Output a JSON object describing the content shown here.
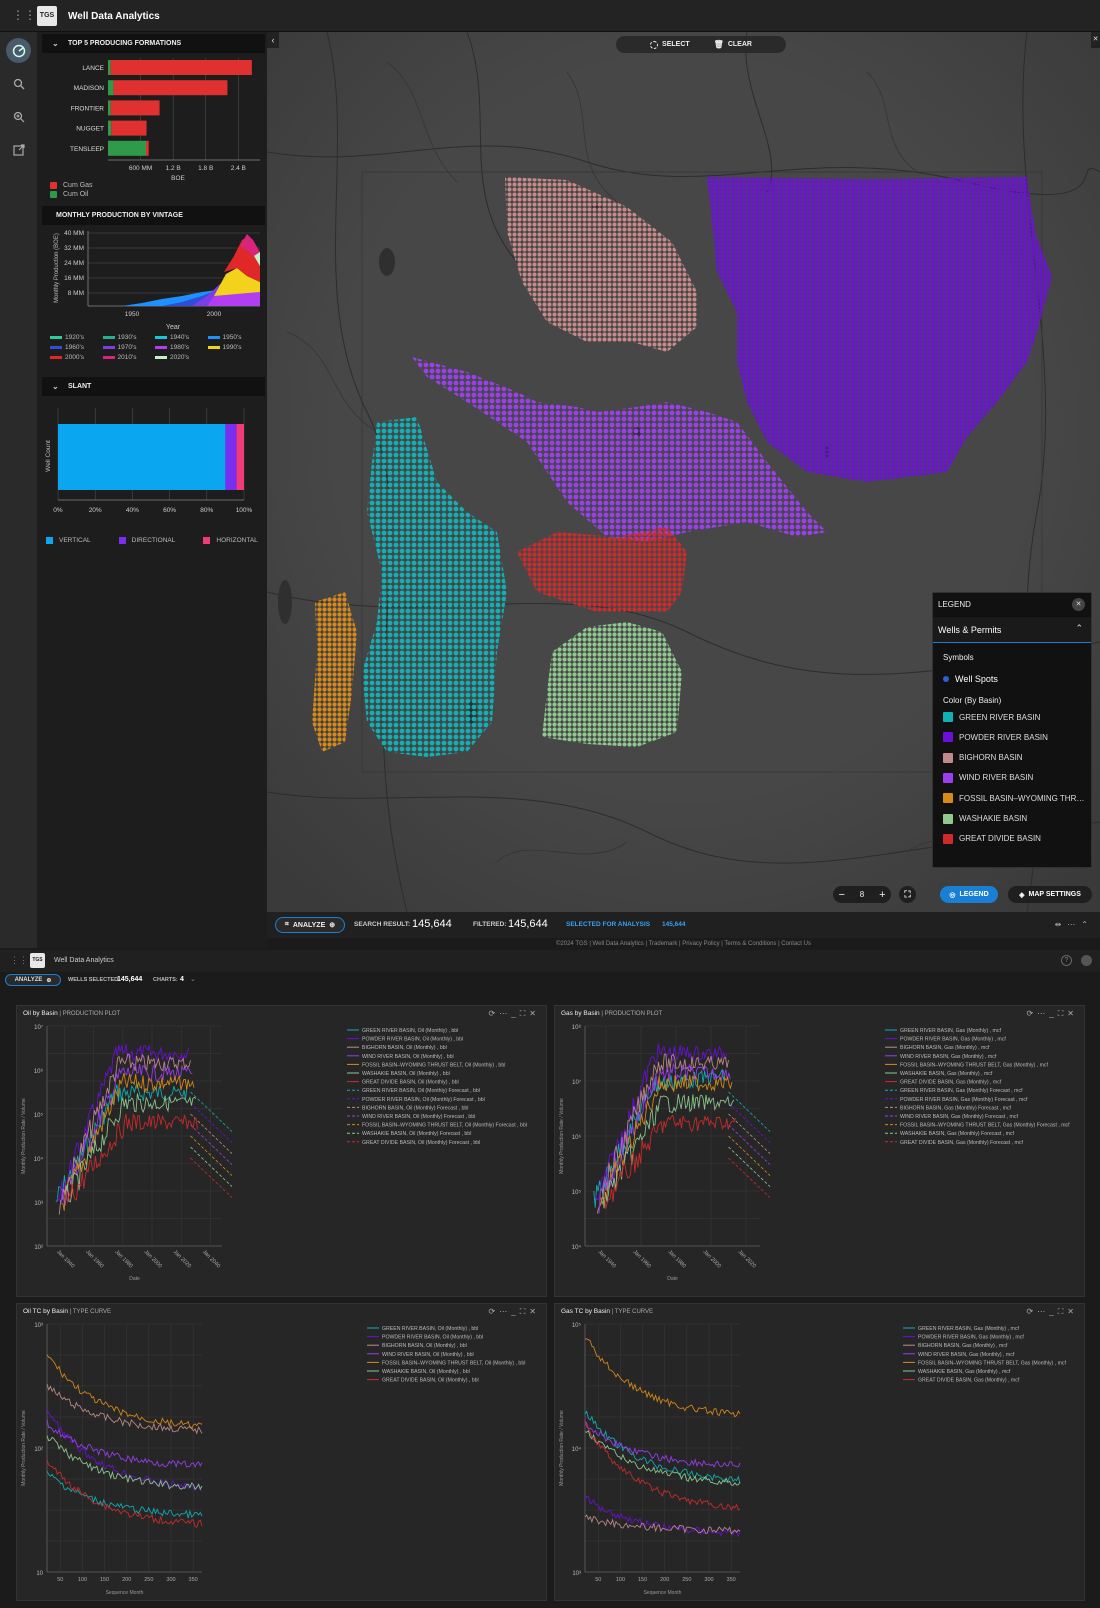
{
  "app": {
    "title": "Well Data Analytics",
    "logo_text": "TGS"
  },
  "panel": {
    "formations": {
      "title": "TOP 5 PRODUCING FORMATIONS",
      "xlabel": "BOE",
      "ticks": [
        "600 MM",
        "1.2 B",
        "1.8 B",
        "2.4 B"
      ],
      "legend": [
        {
          "label": "Cum Gas",
          "color": "#e03030"
        },
        {
          "label": "Cum Oil",
          "color": "#2e9a4a"
        }
      ]
    },
    "vintage": {
      "title": "MONTHLY PRODUCTION BY VINTAGE",
      "ylabel": "Monthly Production (BOE)",
      "xlabel": "Year",
      "yticks": [
        "40 MM",
        "32 MM",
        "24 MM",
        "16 MM",
        "8 MM"
      ],
      "xticks": [
        "1950",
        "2000"
      ],
      "legend": [
        {
          "label": "1920's",
          "color": "#2ecc9a"
        },
        {
          "label": "1930's",
          "color": "#27b08a"
        },
        {
          "label": "1940's",
          "color": "#19c5d8"
        },
        {
          "label": "1950's",
          "color": "#1e90ff"
        },
        {
          "label": "1960's",
          "color": "#2f4dd8"
        },
        {
          "label": "1970's",
          "color": "#7b3fe4"
        },
        {
          "label": "1980's",
          "color": "#b13ef0"
        },
        {
          "label": "1990's",
          "color": "#f2d21b"
        },
        {
          "label": "2000's",
          "color": "#e02828"
        },
        {
          "label": "2010's",
          "color": "#d8247a"
        },
        {
          "label": "2020's",
          "color": "#c8f0c8"
        }
      ]
    },
    "slant": {
      "title": "SLANT",
      "ylabel": "Well Count",
      "xticks": [
        "0%",
        "20%",
        "40%",
        "60%",
        "80%",
        "100%"
      ],
      "legend": [
        {
          "label": "VERTICAL",
          "color": "#0aa6f0"
        },
        {
          "label": "DIRECTIONAL",
          "color": "#7a2ff0"
        },
        {
          "label": "HORIZONTAL",
          "color": "#f03a7a"
        }
      ]
    }
  },
  "map": {
    "select_label": "SELECT",
    "clear_label": "CLEAR",
    "zoom": "8",
    "legend_button": "LEGEND",
    "map_settings": "MAP SETTINGS",
    "legend": {
      "title": "LEGEND",
      "group": "Wells & Permits",
      "symbols_label": "Symbols",
      "symbol": "Well Spots",
      "color_label": "Color (By Basin)",
      "basins": [
        {
          "label": "GREEN RIVER BASIN",
          "color": "#10b0b4"
        },
        {
          "label": "POWDER RIVER BASIN",
          "color": "#6a10d8"
        },
        {
          "label": "BIGHORN BASIN",
          "color": "#c08a8a"
        },
        {
          "label": "WIND RIVER BASIN",
          "color": "#9a3ef0"
        },
        {
          "label": "FOSSIL BASIN–WYOMING THR…",
          "color": "#d88a18"
        },
        {
          "label": "WASHAKIE BASIN",
          "color": "#90c890"
        },
        {
          "label": "GREAT DIVIDE BASIN",
          "color": "#d02a2a"
        }
      ]
    }
  },
  "status": {
    "analyze_label": "ANALYZE",
    "search_label": "SEARCH RESULT:",
    "search_value": "145,644",
    "filtered_label": "FILTERED:",
    "filtered_value": "145,644",
    "selected_label": "SELECTED FOR ANALYSIS",
    "selected_value": "145,644"
  },
  "footer": {
    "text": "©2024 TGS | Well Data Analytics | Trademark | Privacy Policy | Terms & Conditions | Contact Us"
  },
  "analysis": {
    "title": "Well Data Analytics",
    "logo_text": "TGS",
    "analyze_label": "ANALYZE",
    "wells_label": "WELLS SELECTED:",
    "wells_value": "145,644",
    "charts_label": "CHARTS:",
    "charts_value": "4"
  },
  "charts": [
    {
      "title": "Oil by Basin",
      "subtitle": "PRODUCTION PLOT",
      "ylabel": "Monthly Production Rate / Volume",
      "xlabel": "Date",
      "xticks": [
        "Jan 1940",
        "Jan 1960",
        "Jan 1980",
        "Jan 2000",
        "Jan 2020",
        "Jan 2040"
      ],
      "yticks": [
        "10⁷",
        "10⁶",
        "10⁵",
        "10⁴",
        "10³",
        "10²"
      ],
      "legend": [
        "GREEN RIVER BASIN, Oil (Monthly) , bbl",
        "POWDER RIVER BASIN, Oil (Monthly) , bbl",
        "BIGHORN BASIN, Oil (Monthly) , bbl",
        "WIND RIVER BASIN, Oil (Monthly) , bbl",
        "FOSSIL BASIN–WYOMING THRUST BELT, Oil (Monthly) , bbl",
        "WASHAKIE BASIN, Oil (Monthly) , bbl",
        "GREAT DIVIDE BASIN, Oil (Monthly) , bbl",
        "GREEN RIVER BASIN, Oil (Monthly) Forecast , bbl",
        "POWDER RIVER BASIN, Oil (Monthly) Forecast , bbl",
        "BIGHORN BASIN, Oil (Monthly) Forecast , bbl",
        "WIND RIVER BASIN, Oil (Monthly) Forecast , bbl",
        "FOSSIL BASIN–WYOMING THRUST BELT, Oil (Monthly) Forecast , bbl",
        "WASHAKIE BASIN, Oil (Monthly) Forecast , bbl",
        "GREAT DIVIDE BASIN, Oil (Monthly) Forecast , bbl"
      ]
    },
    {
      "title": "Gas by Basin",
      "subtitle": "PRODUCTION PLOT",
      "ylabel": "Monthly Production Rate / Volume",
      "xlabel": "Date",
      "xticks": [
        "Jan 1940",
        "Jan 1960",
        "Jan 1980",
        "Jan 2000",
        "Jan 2020"
      ],
      "yticks": [
        "10⁸",
        "10⁷",
        "10⁶",
        "10⁵",
        "10⁴"
      ],
      "legend": [
        "GREEN RIVER BASIN, Gas (Monthly) , mcf",
        "POWDER RIVER BASIN, Gas (Monthly) , mcf",
        "BIGHORN BASIN, Gas (Monthly) , mcf",
        "WIND RIVER BASIN, Gas (Monthly) , mcf",
        "FOSSIL BASIN–WYOMING THRUST BELT, Gas (Monthly) , mcf",
        "WASHAKIE BASIN, Gas (Monthly) , mcf",
        "GREAT DIVIDE BASIN, Gas (Monthly) , mcf",
        "GREEN RIVER BASIN, Gas (Monthly) Forecast , mcf",
        "POWDER RIVER BASIN, Gas (Monthly) Forecast , mcf",
        "BIGHORN BASIN, Gas (Monthly) Forecast , mcf",
        "WIND RIVER BASIN, Gas (Monthly) Forecast , mcf",
        "FOSSIL BASIN–WYOMING THRUST BELT, Gas (Monthly) Forecast , mcf",
        "WASHAKIE BASIN, Gas (Monthly) Forecast , mcf",
        "GREAT DIVIDE BASIN, Gas (Monthly) Forecast , mcf"
      ]
    },
    {
      "title": "Oil TC by Basin",
      "subtitle": "TYPE CURVE",
      "ylabel": "Monthly Production Rate / Volume",
      "xlabel": "Sequence Month",
      "xticks": [
        "50",
        "100",
        "150",
        "200",
        "250",
        "300",
        "350"
      ],
      "yticks": [
        "10³",
        "10²",
        "10"
      ],
      "legend": [
        "GREEN RIVER BASIN, Oil (Monthly) , bbl",
        "POWDER RIVER BASIN, Oil (Monthly) , bbl",
        "BIGHORN BASIN, Oil (Monthly) , bbl",
        "WIND RIVER BASIN, Oil (Monthly) , bbl",
        "FOSSIL BASIN–WYOMING THRUST BELT, Oil (Monthly) , bbl",
        "WASHAKIE BASIN, Oil (Monthly) , bbl",
        "GREAT DIVIDE BASIN, Oil (Monthly) , bbl"
      ]
    },
    {
      "title": "Gas TC by Basin",
      "subtitle": "TYPE CURVE",
      "ylabel": "Monthly Production Rate / Volume",
      "xlabel": "Sequence Month",
      "xticks": [
        "50",
        "100",
        "150",
        "200",
        "250",
        "300",
        "350"
      ],
      "yticks": [
        "10⁵",
        "10⁴",
        "10³"
      ],
      "legend": [
        "GREEN RIVER BASIN, Gas (Monthly) , mcf",
        "POWDER RIVER BASIN, Gas (Monthly) , mcf",
        "BIGHORN BASIN, Gas (Monthly) , mcf",
        "WIND RIVER BASIN, Gas (Monthly) , mcf",
        "FOSSIL BASIN–WYOMING THRUST BELT, Gas (Monthly) , mcf",
        "WASHAKIE BASIN, Gas (Monthly) , mcf",
        "GREAT DIVIDE BASIN, Gas (Monthly) , mcf"
      ]
    }
  ],
  "chart_data": [
    {
      "type": "bar",
      "title": "TOP 5 PRODUCING FORMATIONS",
      "xlabel": "BOE",
      "categories": [
        "LANCE",
        "MADISON",
        "FRONTIER",
        "NUGGET",
        "TENSLEEP"
      ],
      "series": [
        {
          "name": "Cum Oil",
          "values": [
            0.05,
            0.1,
            0.05,
            0.06,
            0.7
          ]
        },
        {
          "name": "Cum Gas",
          "values": [
            2.6,
            2.1,
            0.9,
            0.65,
            0.05
          ]
        }
      ],
      "xlim": [
        0,
        2.8
      ],
      "units": "B BOE",
      "stacked": true
    },
    {
      "type": "bar",
      "title": "SLANT",
      "ylabel": "Well Count",
      "categories": [
        "VERTICAL",
        "DIRECTIONAL",
        "HORIZONTAL"
      ],
      "values": [
        90,
        6,
        4
      ],
      "units": "%",
      "stacked": true
    }
  ]
}
